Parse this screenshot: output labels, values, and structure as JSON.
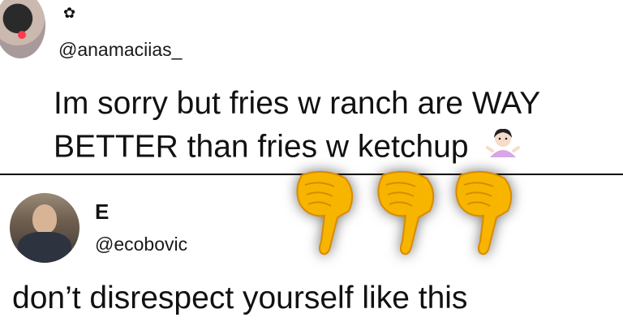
{
  "tweet1": {
    "display_name_glyph": "✿",
    "handle": "@anamaciias_",
    "text": "Im sorry but fries w ranch are WAY BETTER than fries w ketchup"
  },
  "tweet2": {
    "display_name": "E",
    "handle": "@ecobovic",
    "text": "don’t disrespect yourself like this"
  },
  "icons": {
    "shrug_emoji": "person-shrugging-icon",
    "pointing_hands": [
      "backhand-index-pointing-down-icon",
      "backhand-index-pointing-down-icon",
      "backhand-index-pointing-down-icon"
    ]
  },
  "colors": {
    "text": "#111111",
    "divider": "#000000",
    "hand_fill": "#f7b500",
    "hand_shade": "#e08e00"
  }
}
